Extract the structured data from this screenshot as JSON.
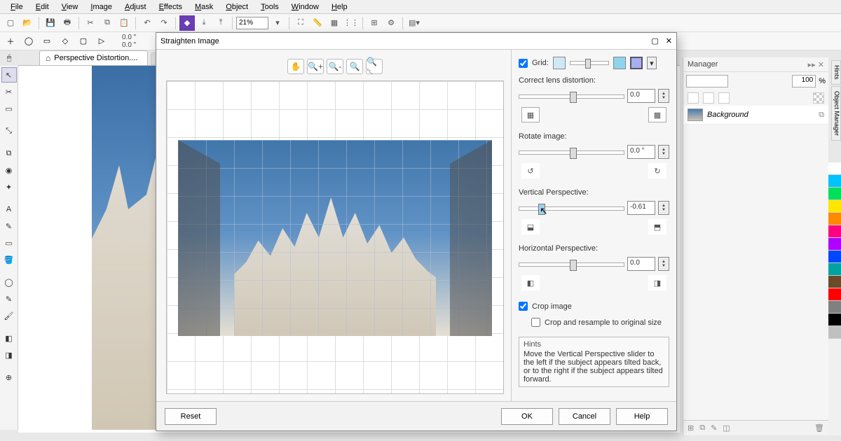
{
  "menu": [
    "File",
    "Edit",
    "View",
    "Image",
    "Adjust",
    "Effects",
    "Mask",
    "Object",
    "Tools",
    "Window",
    "Help"
  ],
  "zoom": "21%",
  "coords": {
    "x": "0.0 \"",
    "y": "0.0 \""
  },
  "tab": {
    "title": "Perspective Distortion...."
  },
  "rightPanel": {
    "title": "Manager",
    "opacity": "100",
    "pct": "%",
    "layer": "Background"
  },
  "dialog": {
    "title": "Straighten Image",
    "gridLabel": "Grid:",
    "gridChecked": true,
    "sections": {
      "lens": {
        "label": "Correct lens distortion:",
        "value": "0.0"
      },
      "rotate": {
        "label": "Rotate image:",
        "value": "0.0 °"
      },
      "vpersp": {
        "label": "Vertical Perspective:",
        "value": "-0.61"
      },
      "hpersp": {
        "label": "Horizontal Perspective:",
        "value": "0.0"
      }
    },
    "cropImage": {
      "label": "Crop image",
      "checked": true
    },
    "cropResample": {
      "label": "Crop and resample to original size",
      "checked": false
    },
    "hints": {
      "title": "Hints",
      "body": "Move the Vertical Perspective slider to the left if the subject appears tilted back, or to the right if the subject appears tilted forward."
    },
    "buttons": {
      "reset": "Reset",
      "ok": "OK",
      "cancel": "Cancel",
      "help": "Help"
    }
  },
  "sideTabs": [
    "Hints",
    "Object Manager"
  ],
  "colors": [
    "#ffffff",
    "#00c2ff",
    "#00e05a",
    "#ffe600",
    "#ff8a00",
    "#ff0080",
    "#b000ff",
    "#0047ff",
    "#00a2a2",
    "#6b4a2a",
    "#ff0000",
    "#808080",
    "#000000",
    "#c0c0c0"
  ]
}
